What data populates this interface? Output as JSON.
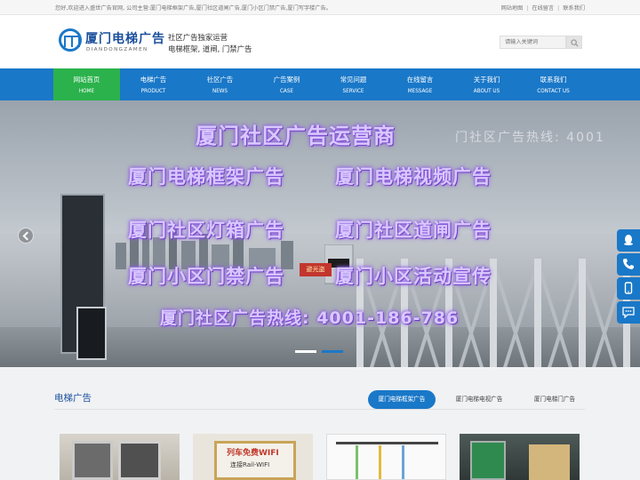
{
  "topbar": {
    "welcome": "您好,欢迎进入盛世广告官网, 公司主营:厦门电梯框架广告,厦门社区道闸广告,厦门小区门禁广告,厦门写字楼广告。",
    "links": [
      "网站地图",
      "在线留言",
      "联系我们"
    ]
  },
  "header": {
    "logo_title": "厦门电梯广告",
    "logo_sub": "DIANDONGZAMEN",
    "slogan_line1": "社区广告独家运营",
    "slogan_line2": "电梯框架, 道闸, 门禁广告",
    "search_placeholder": "请输入关键词"
  },
  "nav": [
    {
      "cn": "网站首页",
      "en": "HOME",
      "active": true
    },
    {
      "cn": "电梯广告",
      "en": "PRODUCT",
      "active": false
    },
    {
      "cn": "社区广告",
      "en": "NEWS",
      "active": false
    },
    {
      "cn": "广告案例",
      "en": "CASE",
      "active": false
    },
    {
      "cn": "常见问题",
      "en": "SERVICE",
      "active": false
    },
    {
      "cn": "在线留言",
      "en": "MESSAGE",
      "active": false
    },
    {
      "cn": "关于我们",
      "en": "ABOUT US",
      "active": false
    },
    {
      "cn": "联系我们",
      "en": "CONTACT US",
      "active": false
    }
  ],
  "banner": {
    "title": "厦门社区广告运营商",
    "line1_left": "厦门电梯框架广告",
    "line1_right": "厦门电梯视频广告",
    "line2_left": "厦门社区灯箱广告",
    "line2_right": "厦门社区道闸广告",
    "line3_left": "厦门小区门禁广告",
    "line3_right": "厦门小区活动宣传",
    "hotline": "厦门社区广告热线: 4001-186-786",
    "ghost_text": "门社区广告热线: 4001",
    "booth_sign": "避光盗"
  },
  "section": {
    "title": "电梯广告",
    "tabs": [
      {
        "label": "厦门电梯框架广告",
        "active": true
      },
      {
        "label": "厦门电梯电视广告",
        "active": false
      },
      {
        "label": "厦门电梯门广告",
        "active": false
      }
    ],
    "thumb_texts": [
      "列车免费WIFI",
      "连接Rail-WIFI"
    ]
  },
  "colors": {
    "primary": "#1a78c8",
    "nav_active": "#2bb24c",
    "heading": "#1a4f9c"
  }
}
